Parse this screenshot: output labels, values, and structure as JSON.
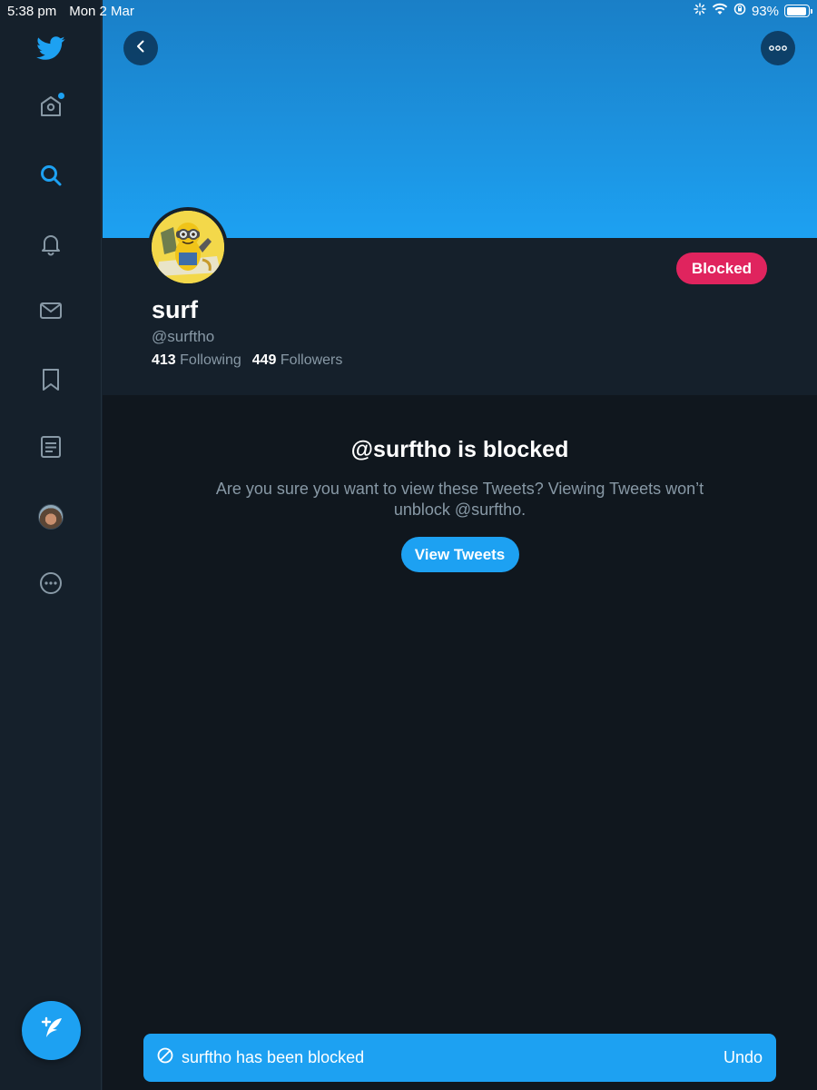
{
  "status_bar": {
    "time": "5:38 pm",
    "date": "Mon 2 Mar",
    "battery": "93%",
    "battery_level": 0.93
  },
  "sidebar": {
    "items": [
      {
        "icon": "twitter-logo-icon"
      },
      {
        "icon": "home-icon",
        "has_notification": true
      },
      {
        "icon": "search-icon",
        "active": true
      },
      {
        "icon": "bell-icon"
      },
      {
        "icon": "mail-icon"
      },
      {
        "icon": "bookmark-icon"
      },
      {
        "icon": "list-icon"
      },
      {
        "icon": "profile-avatar"
      },
      {
        "icon": "more-icon"
      }
    ],
    "compose_icon": "compose-tweet-icon"
  },
  "profile": {
    "display_name": "surf",
    "handle": "@surftho",
    "following_count": "413",
    "following_label": "Following",
    "followers_count": "449",
    "followers_label": "Followers",
    "blocked_button_label": "Blocked"
  },
  "blocked_notice": {
    "title": "@surftho is blocked",
    "body": "Are you sure you want to view these Tweets? Viewing Tweets won’t unblock @surftho.",
    "button_label": "View Tweets"
  },
  "toast": {
    "message": "surftho has been blocked",
    "action_label": "Undo"
  },
  "colors": {
    "accent": "#1da1f2",
    "blocked": "#e0245e",
    "background": "#15202b",
    "muted_text": "#8899a6"
  }
}
